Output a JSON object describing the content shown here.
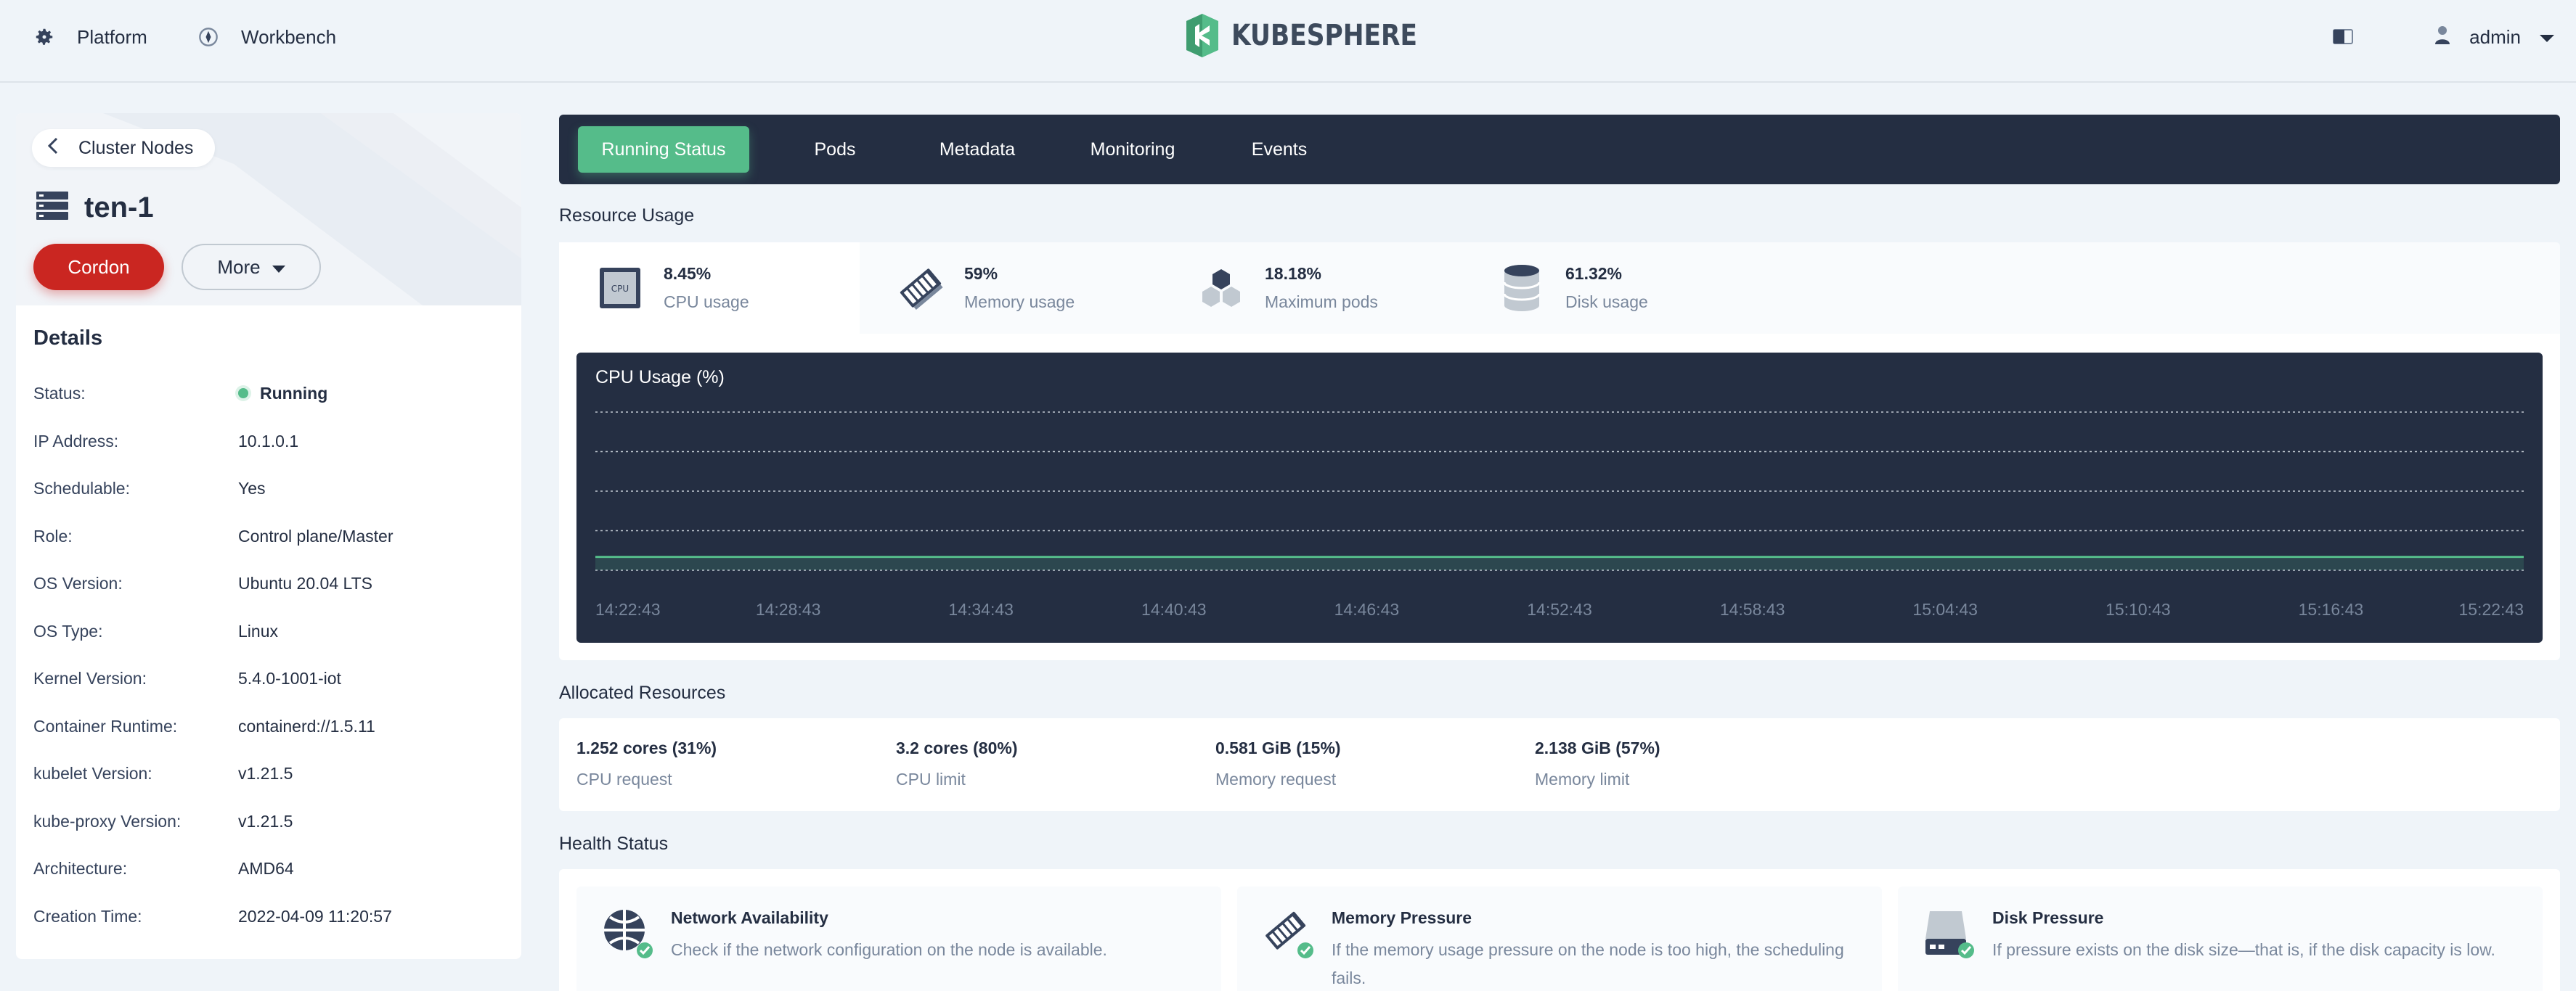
{
  "header": {
    "nav": [
      {
        "label": "Platform",
        "icon": "gear-icon"
      },
      {
        "label": "Workbench",
        "icon": "workbench-icon"
      }
    ],
    "logo_text": "KUBESPHERE",
    "user": "admin"
  },
  "node": {
    "back_label": "Cluster Nodes",
    "name": "ten-1",
    "cordon_label": "Cordon",
    "more_label": "More"
  },
  "details": {
    "title": "Details",
    "rows": [
      {
        "label": "Status:",
        "value": "Running"
      },
      {
        "label": "IP Address:",
        "value": "10.1.0.1"
      },
      {
        "label": "Schedulable:",
        "value": "Yes"
      },
      {
        "label": "Role:",
        "value": "Control plane/Master"
      },
      {
        "label": "OS Version:",
        "value": "Ubuntu 20.04 LTS"
      },
      {
        "label": "OS Type:",
        "value": "Linux"
      },
      {
        "label": "Kernel Version:",
        "value": "5.4.0-1001-iot"
      },
      {
        "label": "Container Runtime:",
        "value": "containerd://1.5.11"
      },
      {
        "label": "kubelet Version:",
        "value": "v1.21.5"
      },
      {
        "label": "kube-proxy Version:",
        "value": "v1.21.5"
      },
      {
        "label": "Architecture:",
        "value": "AMD64"
      },
      {
        "label": "Creation Time:",
        "value": "2022-04-09 11:20:57"
      }
    ]
  },
  "tabs": [
    {
      "label": "Running Status",
      "active": true
    },
    {
      "label": "Pods",
      "active": false
    },
    {
      "label": "Metadata",
      "active": false
    },
    {
      "label": "Monitoring",
      "active": false
    },
    {
      "label": "Events",
      "active": false
    }
  ],
  "resource_usage": {
    "title": "Resource Usage",
    "items": [
      {
        "value": "8.45%",
        "label": "CPU usage",
        "icon": "cpu-icon"
      },
      {
        "value": "59%",
        "label": "Memory usage",
        "icon": "memory-icon"
      },
      {
        "value": "18.18%",
        "label": "Maximum pods",
        "icon": "pods-icon"
      },
      {
        "value": "61.32%",
        "label": "Disk usage",
        "icon": "disk-icon"
      }
    ]
  },
  "chart_data": {
    "type": "line",
    "title": "CPU Usage (%)",
    "xlabel": "",
    "ylabel": "",
    "x": [
      "14:22:43",
      "14:28:43",
      "14:34:43",
      "14:40:43",
      "14:46:43",
      "14:52:43",
      "14:58:43",
      "15:04:43",
      "15:10:43",
      "15:16:43",
      "15:22:43"
    ],
    "series": [
      {
        "values": [
          8.45,
          8.45,
          8.45,
          8.45,
          8.45,
          8.45,
          8.45,
          8.45,
          8.45,
          8.45,
          8.45
        ]
      }
    ],
    "ylim": [
      0,
      100
    ],
    "grid": true,
    "colors": {
      "line": "#55bc8a",
      "background": "#242e42",
      "grid": "#c1c9d1"
    }
  },
  "allocated": {
    "title": "Allocated Resources",
    "items": [
      {
        "value": "1.252 cores (31%)",
        "label": "CPU request"
      },
      {
        "value": "3.2 cores (80%)",
        "label": "CPU limit"
      },
      {
        "value": "0.581 GiB (15%)",
        "label": "Memory request"
      },
      {
        "value": "2.138 GiB (57%)",
        "label": "Memory limit"
      }
    ]
  },
  "health": {
    "title": "Health Status",
    "items": [
      {
        "title": "Network Availability",
        "desc": "Check if the network configuration on the node is available.",
        "icon": "network-icon"
      },
      {
        "title": "Memory Pressure",
        "desc": "If the memory usage pressure on the node is too high, the scheduling fails.",
        "icon": "memory-pressure-icon"
      },
      {
        "title": "Disk Pressure",
        "desc": "If pressure exists on the disk size—that is, if the disk capacity is low.",
        "icon": "disk-pressure-icon"
      }
    ]
  },
  "colors": {
    "accent": "#55bc8a",
    "danger": "#ca2621",
    "dark": "#242e42",
    "background": "#eff4f9"
  }
}
